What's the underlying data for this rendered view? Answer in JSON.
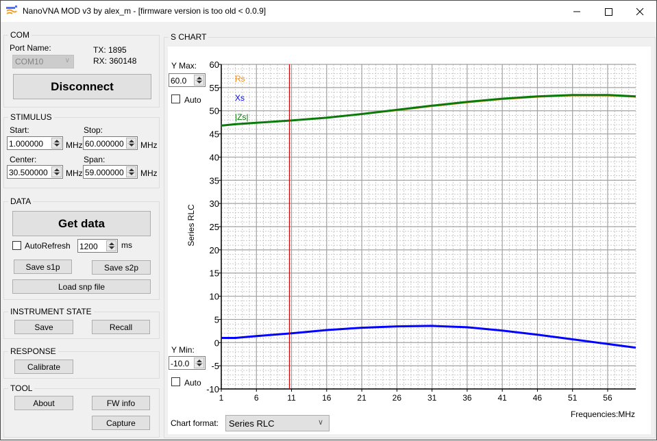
{
  "window": {
    "title": "NanoVNA MOD v3 by alex_m - [firmware version is too old < 0.0.9]",
    "controls": {
      "minimize": "—",
      "maximize": "☐",
      "close": "✕"
    }
  },
  "com": {
    "group_label": "COM",
    "port_name_label": "Port Name:",
    "port_value": "COM10",
    "tx": "TX: 1895",
    "rx": "RX: 360148",
    "disconnect_label": "Disconnect"
  },
  "stimulus": {
    "group_label": "STIMULUS",
    "start_label": "Start:",
    "start_value": "1.000000",
    "stop_label": "Stop:",
    "stop_value": "60.000000",
    "center_label": "Center:",
    "center_value": "30.500000",
    "span_label": "Span:",
    "span_value": "59.000000",
    "unit": "MHz"
  },
  "data": {
    "group_label": "DATA",
    "get_data_label": "Get data",
    "autorefresh_label": "AutoRefresh",
    "autorefresh_checked": false,
    "interval_value": "1200",
    "interval_unit": "ms",
    "save_s1p_label": "Save s1p",
    "save_s2p_label": "Save s2p",
    "load_snp_label": "Load snp file"
  },
  "instrument_state": {
    "group_label": "INSTRUMENT STATE",
    "save_label": "Save",
    "recall_label": "Recall"
  },
  "response": {
    "group_label": "RESPONSE",
    "calibrate_label": "Calibrate"
  },
  "tool": {
    "group_label": "TOOL",
    "about_label": "About",
    "fw_info_label": "FW info",
    "capture_label": "Capture"
  },
  "s_chart": {
    "group_label": "S CHART",
    "y_max_label": "Y Max:",
    "y_max_value": "60.0",
    "y_max_auto_label": "Auto",
    "y_min_label": "Y Min:",
    "y_min_value": "-10.0",
    "y_min_auto_label": "Auto",
    "chart_format_label": "Chart format:",
    "chart_format_value": "Series RLC"
  },
  "chart_data": {
    "type": "line",
    "title": "",
    "xlabel": "Frequencies:MHz",
    "ylabel": "Series RLC",
    "xlim": [
      1,
      60
    ],
    "ylim": [
      -10,
      60
    ],
    "x_ticks": [
      1,
      6,
      11,
      16,
      21,
      26,
      31,
      36,
      41,
      46,
      51,
      56
    ],
    "y_ticks": [
      60,
      55,
      50,
      45,
      40,
      35,
      30,
      25,
      20,
      15,
      10,
      5,
      0,
      -5,
      -10
    ],
    "grid": true,
    "marker_x": 10.7,
    "legend_position": "top-left",
    "x": [
      1,
      3,
      6,
      11,
      16,
      21,
      26,
      31,
      36,
      41,
      46,
      51,
      56,
      60
    ],
    "series": [
      {
        "name": "Rs",
        "color": "#f0901e",
        "values": [
          46.8,
          47.1,
          47.4,
          47.9,
          48.5,
          49.3,
          50.1,
          51.0,
          51.8,
          52.5,
          53.0,
          53.3,
          53.3,
          53.0
        ]
      },
      {
        "name": "Xs",
        "color": "#0000ff",
        "values": [
          1.0,
          1.0,
          1.4,
          2.0,
          2.7,
          3.2,
          3.5,
          3.6,
          3.3,
          2.6,
          1.7,
          0.7,
          -0.3,
          -1.1
        ]
      },
      {
        "name": "|Zs|",
        "color": "#0a7a0a",
        "values": [
          46.8,
          47.1,
          47.4,
          47.9,
          48.5,
          49.3,
          50.2,
          51.1,
          51.9,
          52.6,
          53.1,
          53.4,
          53.4,
          53.1
        ]
      }
    ],
    "marker_color": "#cc0000"
  }
}
